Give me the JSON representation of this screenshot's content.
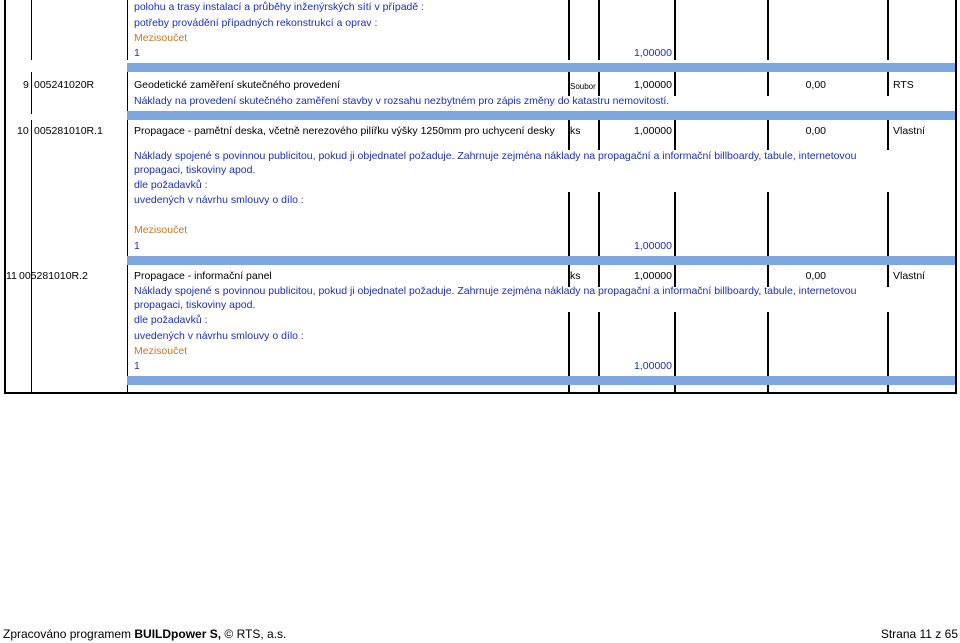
{
  "top": {
    "desc1": "polohu a trasy instalací a průběhy inženýrských sítí  v případě  :",
    "desc2": "potřeby provádění případných rekonstrukcí a oprav :",
    "subtotal_label": "Mezisoučet",
    "count": "1",
    "qty": "1,00000"
  },
  "items": [
    {
      "no": "9",
      "code": "005241020R",
      "name": "Geodetické zaměření skutečného provedení",
      "unit": "Soubor",
      "qty": "1,00000",
      "price": "0,00",
      "source": "RTS",
      "note": "Náklady na provedení skutečného zaměření stavby v rozsahu nezbytném pro zápis změny do katastru nemovitostí."
    },
    {
      "no": "10",
      "code": "005281010R.1",
      "name": "Propagace - pamětní deska, včetně nerezového pilířku výšky 1250mm pro uchycení desky",
      "unit": "ks",
      "qty": "1,00000",
      "price": "0,00",
      "source": "Vlastní",
      "note_line1": "Náklady spojené s povinnou publicitou, pokud ji objednatel požaduje. Zahrnuje zejména náklady na propagační a informační billboardy, tabule, internetovou",
      "note_line2": "propagaci, tiskoviny apod.",
      "req": "dle požadavků :",
      "contract": "uvedených v návrhu smlouvy o dílo  :",
      "subtotal_label": "Mezisoučet",
      "count": "1",
      "sub_qty": "1,00000"
    },
    {
      "no": "11",
      "code": "005281010R.2",
      "name": "Propagace - informační panel",
      "unit": "ks",
      "qty": "1,00000",
      "price": "0,00",
      "source": "Vlastní",
      "note_line1": "Náklady spojené s povinnou publicitou, pokud ji objednatel požaduje. Zahrnuje zejména náklady na propagační a informační billboardy, tabule, internetovou",
      "note_line2": "propagaci, tiskoviny apod.",
      "req": "dle požadavků :",
      "contract": "uvedených v návrhu smlouvy o dílo  :",
      "subtotal_label": "Mezisoučet",
      "count": "1",
      "sub_qty": "1,00000"
    }
  ],
  "footer": {
    "left_prefix": "Zpracováno programem ",
    "left_brand": "BUILDpower S,",
    "left_suffix": "  © RTS, a.s.",
    "right": "Strana 11 z 65"
  },
  "colors": {
    "band": "#7fa7df",
    "blue_text": "#1f2fb8",
    "orange_text": "#c8782a"
  }
}
